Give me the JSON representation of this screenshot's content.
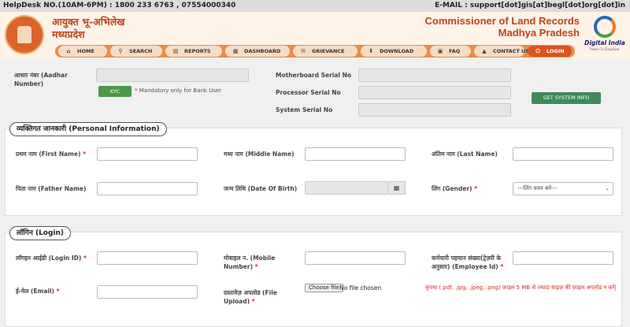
{
  "topbar": {
    "helpdesk": "HelpDesk NO.(10AM-6PM) : 1800 233 6763 , 07554000340",
    "email": "E-MAIL : support[dot]gis[at]begl[dot]org[dot]in"
  },
  "header": {
    "org_hi_line1": "आयुक्त भू-अभिलेख",
    "org_hi_line2": "मध्यप्रदेश",
    "title_line1": "Commissioner of Land Records",
    "title_line2": "Madhya Pradesh",
    "logo_text": "Digital India",
    "logo_tagline": "Power To Empower"
  },
  "nav": [
    {
      "label": "HOME",
      "icon": "home-icon"
    },
    {
      "label": "SEARCH",
      "icon": "search-icon"
    },
    {
      "label": "REPORTS",
      "icon": "reports-icon"
    },
    {
      "label": "DASHBOARD",
      "icon": "dashboard-icon"
    },
    {
      "label": "GRIEVANCE",
      "icon": "grievance-icon"
    },
    {
      "label": "DOWNLOAD",
      "icon": "download-icon"
    },
    {
      "label": "FAQ",
      "icon": "faq-icon"
    },
    {
      "label": "CONTACT US",
      "icon": "contact-icon"
    },
    {
      "label": "LOGIN",
      "icon": "login-icon",
      "active": true
    }
  ],
  "device": {
    "aadhar_label_1": "आधार नंबर (Aadhar",
    "aadhar_label_2": "Number)",
    "kyc_button": "KYC",
    "kyc_note": "Mandatory only for Bank User",
    "motherboard_label": "Motherboard Serial No",
    "processor_label": "Processor Serial No",
    "system_label": "System Serial No",
    "get_info_button": "GET SYSTEM INFO"
  },
  "personal": {
    "legend": "व्यक्तिगत जानकारी (Personal Information)",
    "first_name": "प्रथम नाम (First Name)",
    "middle_name": "मध्य नाम (Middle Name)",
    "last_name": "अंतिम नाम (Last Name)",
    "father_name": "पिता नाम (Father Name)",
    "dob": "जन्म तिथि (Date Of Birth)",
    "gender": "लिंग (Gender)",
    "gender_select": "---लिंग चयन करे---"
  },
  "login": {
    "legend": "लॉगिन (Login)",
    "login_id": "लॉगइन आईडी (Login ID)",
    "mobile_1": "मोबाइल न. (Mobile",
    "mobile_2": "Number)",
    "employee_1": "कर्मचारी पहचान संख्या(ट्रेज़री के",
    "employee_2": "अनुसार) (Employee Id)",
    "email": "ई-मेल (Email)",
    "file_upload_1": "दस्तावेज़ अपलोड (File",
    "file_upload_2": "Upload)",
    "choose_file": "Choose file",
    "no_file": "No file chosen",
    "file_note": "कृपया (.pdf, .jpg, .jpeg, .png) फ़ाइल 5 MB से ज्यादा साइज़ की फ़ाइल अपलोड न करें|"
  },
  "colors": {
    "accent": "#c0431b",
    "nav_bar": "#e98c4a",
    "active_tab": "#d9531e",
    "button_green": "#4a9a47"
  }
}
